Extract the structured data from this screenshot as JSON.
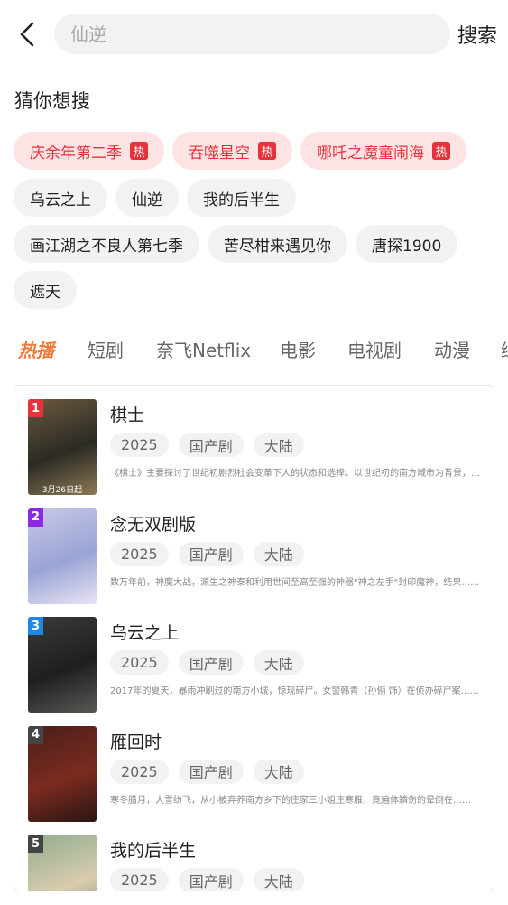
{
  "search": {
    "placeholder": "仙逆",
    "button_label": "搜索"
  },
  "guess": {
    "title": "猜你想搜",
    "hot_badge": "热",
    "rows": [
      [
        {
          "label": "庆余年第二季",
          "hot": true
        },
        {
          "label": "吞噬星空",
          "hot": true
        },
        {
          "label": "哪吒之魔童闹海",
          "hot": true
        }
      ],
      [
        {
          "label": "乌云之上",
          "hot": false
        },
        {
          "label": "仙逆",
          "hot": false
        },
        {
          "label": "我的后半生",
          "hot": false
        }
      ],
      [
        {
          "label": "画江湖之不良人第七季",
          "hot": false
        },
        {
          "label": "苦尽柑来遇见你",
          "hot": false
        },
        {
          "label": "唐探1900",
          "hot": false
        }
      ],
      [
        {
          "label": "遮天",
          "hot": false
        }
      ]
    ]
  },
  "categories": [
    "热播",
    "短剧",
    "奈飞Netflix",
    "电影",
    "电视剧",
    "动漫",
    "综"
  ],
  "active_category": "热播",
  "colors": {
    "accent": "#f07a3a",
    "hot_red": "#e6323a",
    "hot_bg": "#fde3e3",
    "chip_bg": "#f2f2f2"
  },
  "items": [
    {
      "rank": "1",
      "rank_color": "#e8323c",
      "title": "棋士",
      "year": "2025",
      "type": "国产剧",
      "region": "大陆",
      "desc": "《棋士》主要探讨了世纪初剧烈社会变革下人的状态和选择。以世纪初的南方城市为背景，讲述了一个围棋老师的故事……",
      "poster_colors": [
        "#6b5a3e",
        "#2b2a24",
        "#8c7a55"
      ],
      "poster_caption": "3月26日起"
    },
    {
      "rank": "2",
      "rank_color": "#8a2be2",
      "title": "念无双剧版",
      "year": "2025",
      "type": "国产剧",
      "region": "大陆",
      "desc": "数万年前，神魔大战，源生之神泰和利用世间至高至强的神器\"神之左手\"封印魔神，结果……",
      "poster_colors": [
        "#c9c7e6",
        "#9aa4d6",
        "#e8e4f3"
      ],
      "poster_caption": ""
    },
    {
      "rank": "3",
      "rank_color": "#1e88e5",
      "title": "乌云之上",
      "year": "2025",
      "type": "国产剧",
      "region": "大陆",
      "desc": "2017年的夏天，暴雨冲刷过的南方小城，惊现碎尸。女警韩青（孙俪 饰）在侦办碎尸案……",
      "poster_colors": [
        "#3a3a38",
        "#1f1f1e",
        "#5a5855"
      ],
      "poster_caption": ""
    },
    {
      "rank": "4",
      "rank_color": "#444444",
      "title": "雁回时",
      "year": "2025",
      "type": "国产剧",
      "region": "大陆",
      "desc": "寒冬腊月，大雪纷飞，从小被弃养南方乡下的庄家三小姐庄寒雁，竟遍体鳞伤的晕倒在……",
      "poster_colors": [
        "#4a1f1a",
        "#7a2b20",
        "#2b1512"
      ],
      "poster_caption": ""
    },
    {
      "rank": "5",
      "rank_color": "#444444",
      "title": "我的后半生",
      "year": "2025",
      "type": "国产剧",
      "region": "大陆",
      "desc": "",
      "poster_colors": [
        "#8fae8c",
        "#d9cbb0",
        "#6a8a6c"
      ],
      "poster_caption": ""
    }
  ]
}
